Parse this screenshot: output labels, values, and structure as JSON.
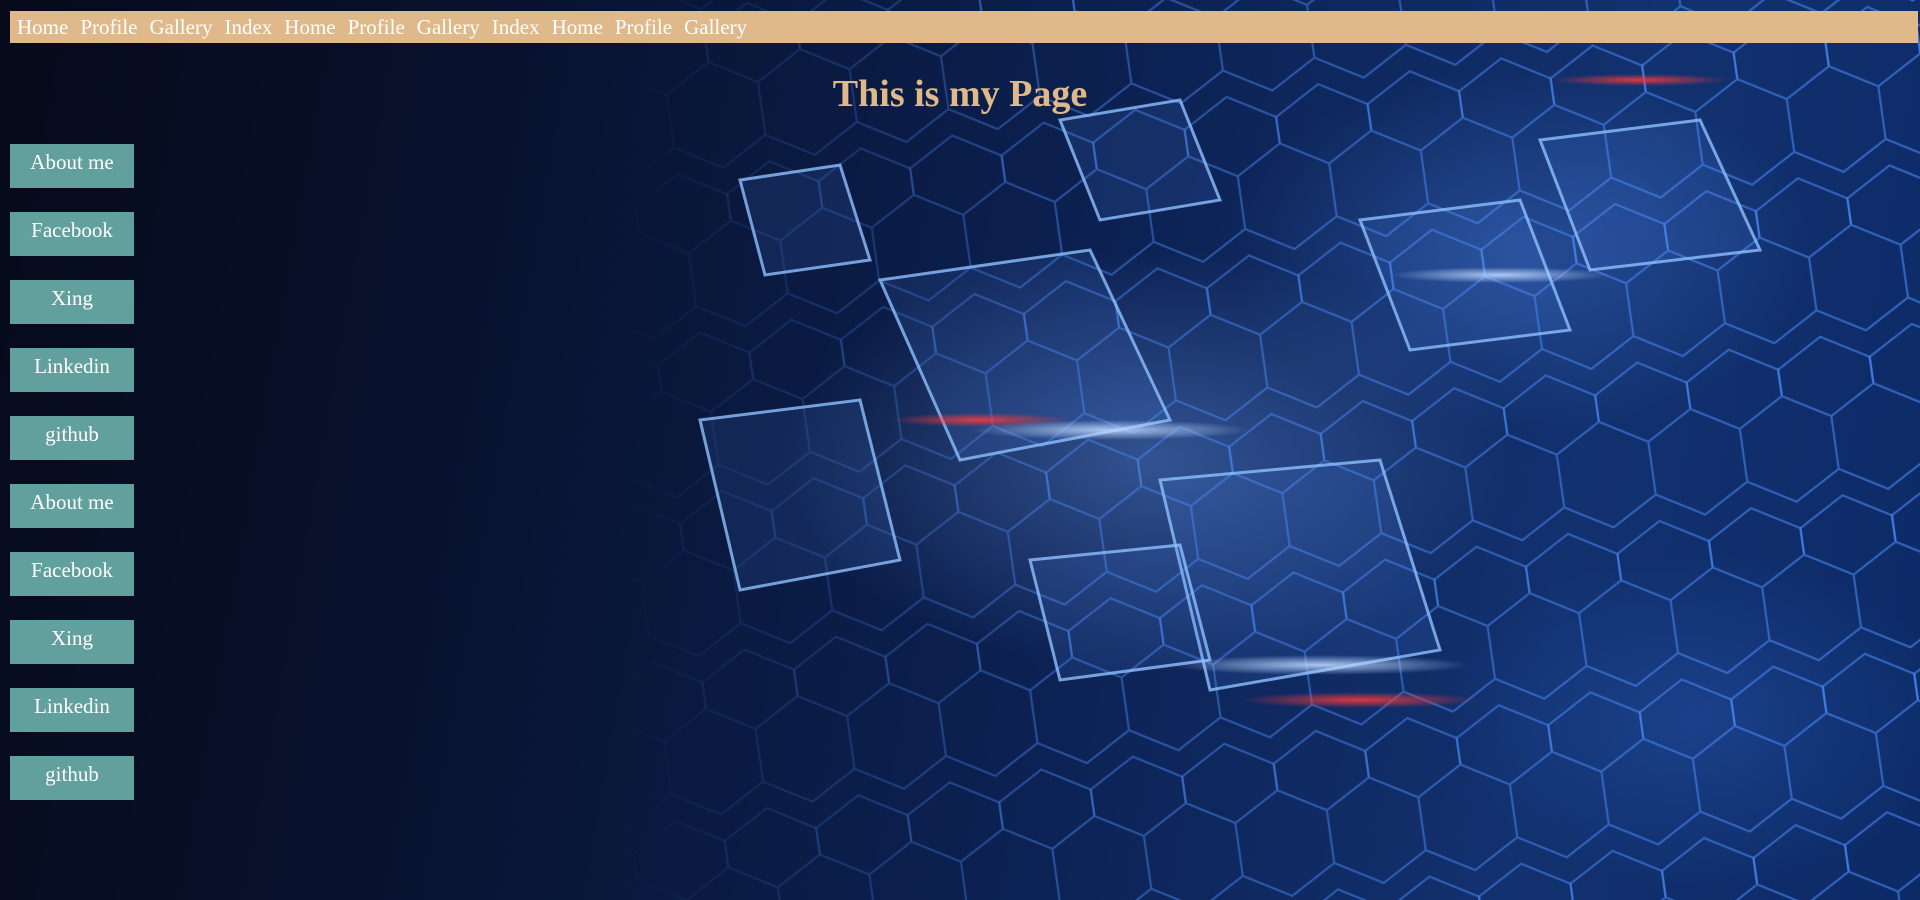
{
  "topnav": {
    "items": [
      {
        "label": "Home"
      },
      {
        "label": "Profile"
      },
      {
        "label": "Gallery"
      },
      {
        "label": "Index"
      },
      {
        "label": "Home"
      },
      {
        "label": "Profile"
      },
      {
        "label": "Gallery"
      },
      {
        "label": "Index"
      },
      {
        "label": "Home"
      },
      {
        "label": "Profile"
      },
      {
        "label": "Gallery"
      }
    ]
  },
  "main": {
    "title": "This is my Page"
  },
  "sidebar": {
    "items": [
      {
        "label": "About me"
      },
      {
        "label": "Facebook"
      },
      {
        "label": "Xing"
      },
      {
        "label": "Linkedin"
      },
      {
        "label": "github"
      },
      {
        "label": "About me"
      },
      {
        "label": "Facebook"
      },
      {
        "label": "Xing"
      },
      {
        "label": "Linkedin"
      },
      {
        "label": "github"
      }
    ]
  },
  "colors": {
    "nav_bar": "#dfb98a",
    "title": "#dfb98a",
    "sidebar_button": "#62a09e",
    "background": "#0c2152"
  }
}
